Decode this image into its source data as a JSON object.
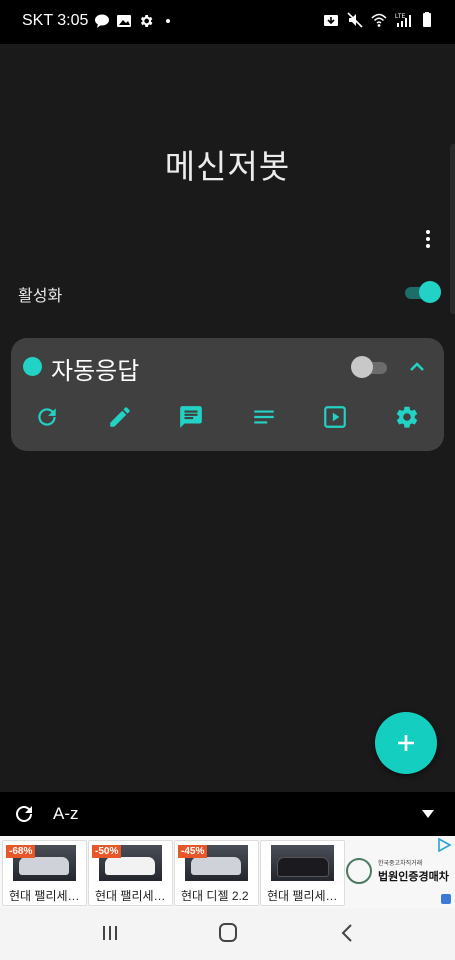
{
  "status_bar": {
    "carrier_time": "SKT 3:05",
    "left_icons": [
      "talk-icon",
      "image-icon",
      "gear-icon",
      "dot-icon"
    ],
    "right_icons": [
      "download-icon",
      "mute-icon",
      "wifi-icon",
      "lte-signal-icon",
      "battery-icon"
    ],
    "network_label": "LTE"
  },
  "app": {
    "title": "메신저봇",
    "menu_icon": "more-vert-icon",
    "activate_label": "활성화",
    "activate_on": true,
    "accent_color": "#22d3c5"
  },
  "bot_card": {
    "name": "자동응답",
    "enabled": false,
    "expanded": true,
    "actions": [
      "refresh-icon",
      "edit-icon",
      "chat-icon",
      "notes-icon",
      "play-icon",
      "gear-icon"
    ]
  },
  "fab": {
    "icon": "plus-icon"
  },
  "bottom_bar": {
    "sort_label": "A-z"
  },
  "ad": {
    "items": [
      {
        "discount": "-68%",
        "text": "현대 팰리세이드"
      },
      {
        "discount": "-50%",
        "text": "현대 팰리세이드"
      },
      {
        "discount": "-45%",
        "text": "현대 디젤 2.2"
      },
      {
        "discount": "",
        "text": "현대 팰리세이드"
      }
    ],
    "brand_small": "한국중고차직거래",
    "brand_main": "법원인증경매차"
  },
  "nav": {
    "icons": [
      "recent-apps-icon",
      "home-icon",
      "back-icon"
    ]
  }
}
